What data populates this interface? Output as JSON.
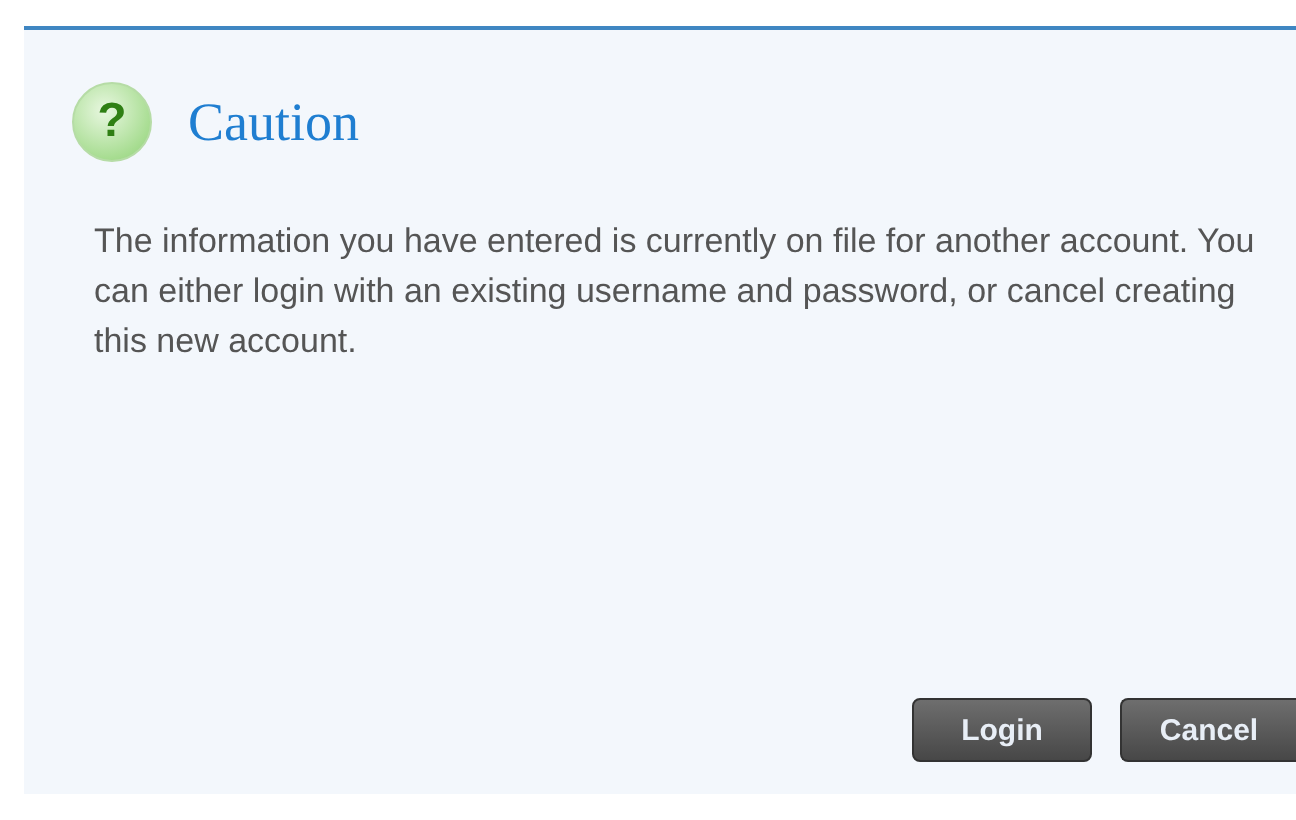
{
  "dialog": {
    "icon_glyph": "?",
    "title": "Caution",
    "message": "The information you have entered is currently on file for another account.  You can either login with an existing username and password, or cancel creating this new account.",
    "buttons": [
      {
        "label": "Login"
      },
      {
        "label": "Cancel"
      }
    ]
  }
}
